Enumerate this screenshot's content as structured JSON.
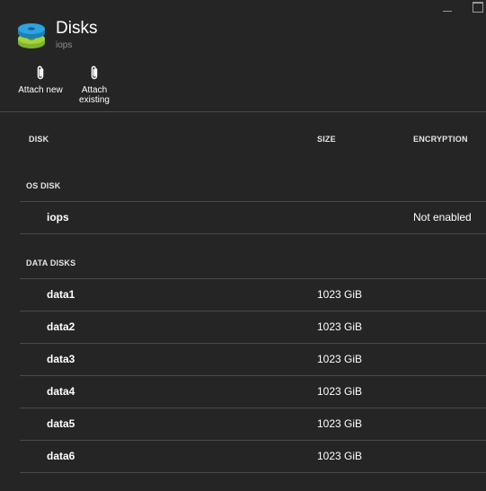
{
  "blade": {
    "title": "Disks",
    "subtitle": "iops",
    "icon": "disks-stack-icon"
  },
  "toolbar": {
    "attach_new_label": "Attach new",
    "attach_existing_line1": "Attach",
    "attach_existing_line2": "existing"
  },
  "table": {
    "columns": {
      "disk": "DISK",
      "size": "SIZE",
      "encryption": "ENCRYPTION"
    },
    "os_disk_section": "OS DISK",
    "os_disks": [
      {
        "name": "iops",
        "size": "",
        "encryption": "Not enabled"
      }
    ],
    "data_disk_section": "DATA DISKS",
    "data_disks": [
      {
        "name": "data1",
        "size": "1023 GiB",
        "encryption": ""
      },
      {
        "name": "data2",
        "size": "1023 GiB",
        "encryption": ""
      },
      {
        "name": "data3",
        "size": "1023 GiB",
        "encryption": ""
      },
      {
        "name": "data4",
        "size": "1023 GiB",
        "encryption": ""
      },
      {
        "name": "data5",
        "size": "1023 GiB",
        "encryption": ""
      },
      {
        "name": "data6",
        "size": "1023 GiB",
        "encryption": ""
      }
    ]
  },
  "colors": {
    "background": "#252526",
    "divider": "#4a4a4a",
    "icon_blue": "#2ea3e0",
    "icon_green": "#9fd63a"
  }
}
